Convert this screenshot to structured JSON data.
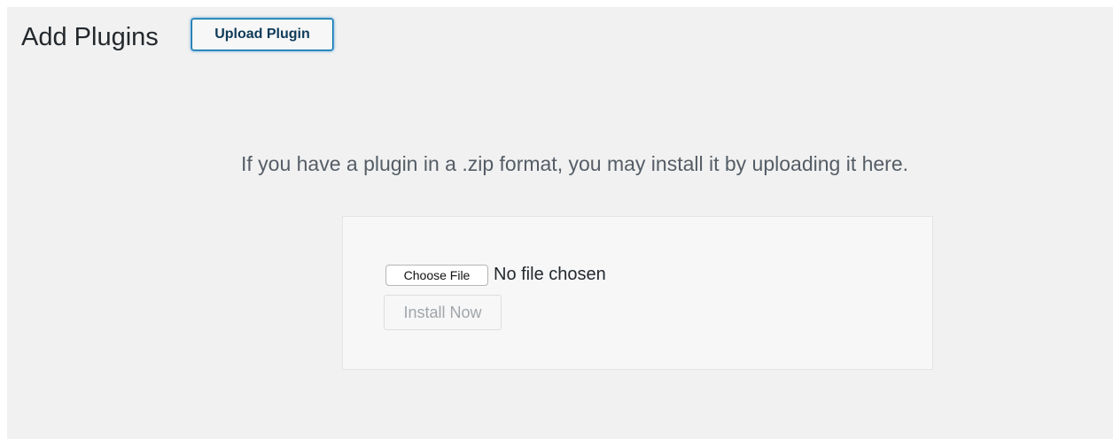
{
  "page": {
    "title": "Add Plugins",
    "upload_button": "Upload Plugin",
    "help_text": "If you have a plugin in a .zip format, you may install it by uploading it here."
  },
  "upload_form": {
    "choose_file_label": "Choose File",
    "file_status": "No file chosen",
    "install_button": "Install Now",
    "install_enabled": false
  },
  "colors": {
    "background": "#f1f1f1",
    "panel": "#f7f7f7",
    "accent": "#0071a1",
    "disabled_text": "#a0a5aa",
    "body_text": "#555d66"
  }
}
